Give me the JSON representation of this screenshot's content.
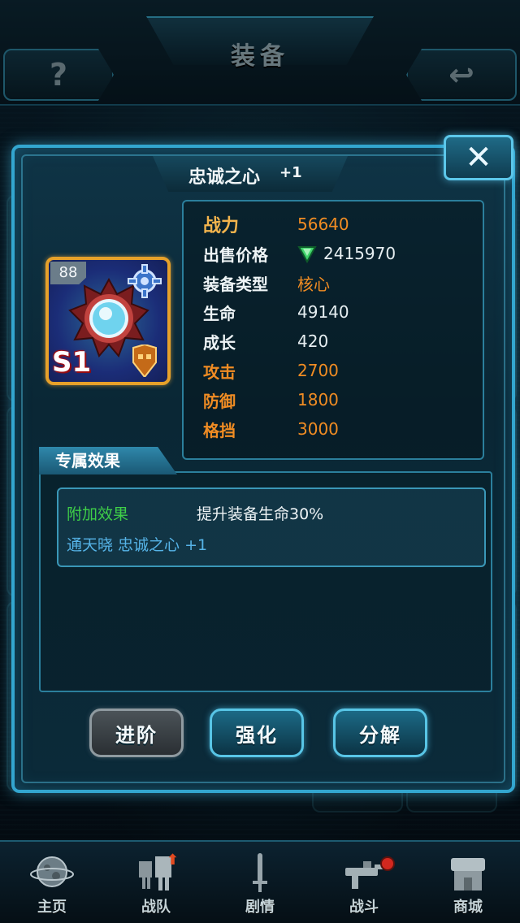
{
  "screen": {
    "title": "装备"
  },
  "header": {
    "help_label": "?",
    "back_label": "↩"
  },
  "dialog": {
    "item_name": "忠诚之心",
    "item_level": "+1",
    "close_label": "✕",
    "card": {
      "level": "88",
      "grade": "S1"
    },
    "stats": [
      {
        "label": "战力",
        "value": "56640",
        "style": "power"
      },
      {
        "label": "出售价格",
        "value": "2415970",
        "style": "price"
      },
      {
        "label": "装备类型",
        "value": "核心",
        "style": "type"
      },
      {
        "label": "生命",
        "value": "49140",
        "style": "normal"
      },
      {
        "label": "成长",
        "value": "420",
        "style": "normal"
      },
      {
        "label": "攻击",
        "value": "2700",
        "style": "hi"
      },
      {
        "label": "防御",
        "value": "1800",
        "style": "hi"
      },
      {
        "label": "格挡",
        "value": "3000",
        "style": "hi"
      }
    ],
    "exclusive": {
      "section_title": "专属效果",
      "effect_label": "附加效果",
      "effect_desc": "提升装备生命30%",
      "effect_source": "通天晓 忠诚之心 +1"
    },
    "buttons": {
      "advance": "进阶",
      "strengthen": "强化",
      "decompose": "分解"
    }
  },
  "bottom_nav": [
    {
      "label": "主页",
      "icon": "planet-icon"
    },
    {
      "label": "战队",
      "icon": "robots-icon"
    },
    {
      "label": "剧情",
      "icon": "sword-icon"
    },
    {
      "label": "战斗",
      "icon": "gun-icon"
    },
    {
      "label": "商城",
      "icon": "shop-icon"
    }
  ],
  "colors": {
    "accent": "#33a6cf",
    "stat_highlight": "#f08c23",
    "effect_green": "#3fcf48",
    "effect_blue": "#56b4e8"
  }
}
